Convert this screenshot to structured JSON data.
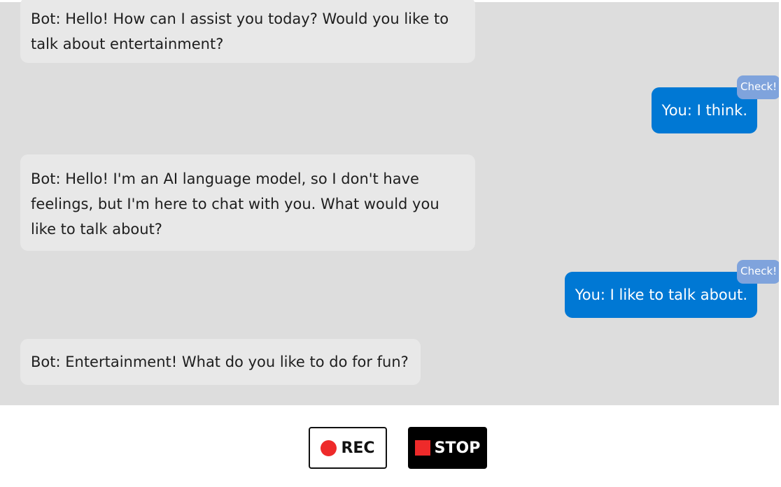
{
  "chat": {
    "messages": [
      {
        "role": "bot",
        "text": "Bot: Hello! How can I assist you today? Would you like to talk about entertainment?"
      },
      {
        "role": "user",
        "text": "You: I think.",
        "check_label": "Check!"
      },
      {
        "role": "bot",
        "text": "Bot: Hello! I'm an AI language model, so I don't have feelings, but I'm here to chat with you. What would you like to talk about?"
      },
      {
        "role": "user",
        "text": "You: I like to talk about.",
        "check_label": "Check!"
      },
      {
        "role": "bot",
        "text": "Bot: Entertainment! What do you like to do for fun?"
      }
    ]
  },
  "controls": {
    "rec_label": "REC",
    "stop_label": "STOP"
  },
  "colors": {
    "chat_background": "#dddddd",
    "bot_bubble": "#e8e8e8",
    "user_bubble": "#0078d4",
    "check_badge": "#7fa3dc",
    "rec_indicator": "#ee2a2a"
  },
  "icons": {
    "rec": "record-dot-icon",
    "stop": "stop-square-icon"
  }
}
